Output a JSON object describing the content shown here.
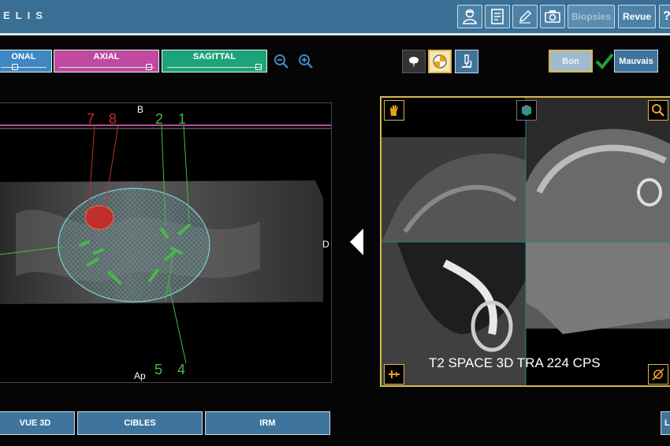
{
  "app": {
    "brand": "ELIS"
  },
  "toolbar": {
    "biopsies_label": "Biopsies",
    "revue_label": "Revue",
    "help_label": "?"
  },
  "views": {
    "coronal_label": "ONAL",
    "axial_label": "AXIAL",
    "sagittal_label": "SAGITTAL"
  },
  "status": {
    "bon_label": "Bon",
    "mauvais_label": "Mauvais"
  },
  "left_viewer": {
    "top_label": "B",
    "bottom_label": "Ap",
    "right_label": "D",
    "target_labels": [
      "7",
      "8",
      "2",
      "1",
      "5",
      "4"
    ]
  },
  "right_viewer": {
    "sequence_label": "T2 SPACE 3D TRA 224 CPS"
  },
  "bottom": {
    "vue3d_label": "VUE 3D",
    "cibles_label": "CIBLES",
    "irm_label": "IRM",
    "right_partial_label": "L"
  },
  "colors": {
    "header_bg": "#3a6e94",
    "coronal_tab": "#3f86c2",
    "axial_tab": "#c04aa0",
    "sagittal_tab": "#1ea27a",
    "frame_yellow": "#d9b84a",
    "target_red": "#c0302a",
    "target_green": "#49b84a",
    "mesh_cyan": "#7fd0d4"
  }
}
